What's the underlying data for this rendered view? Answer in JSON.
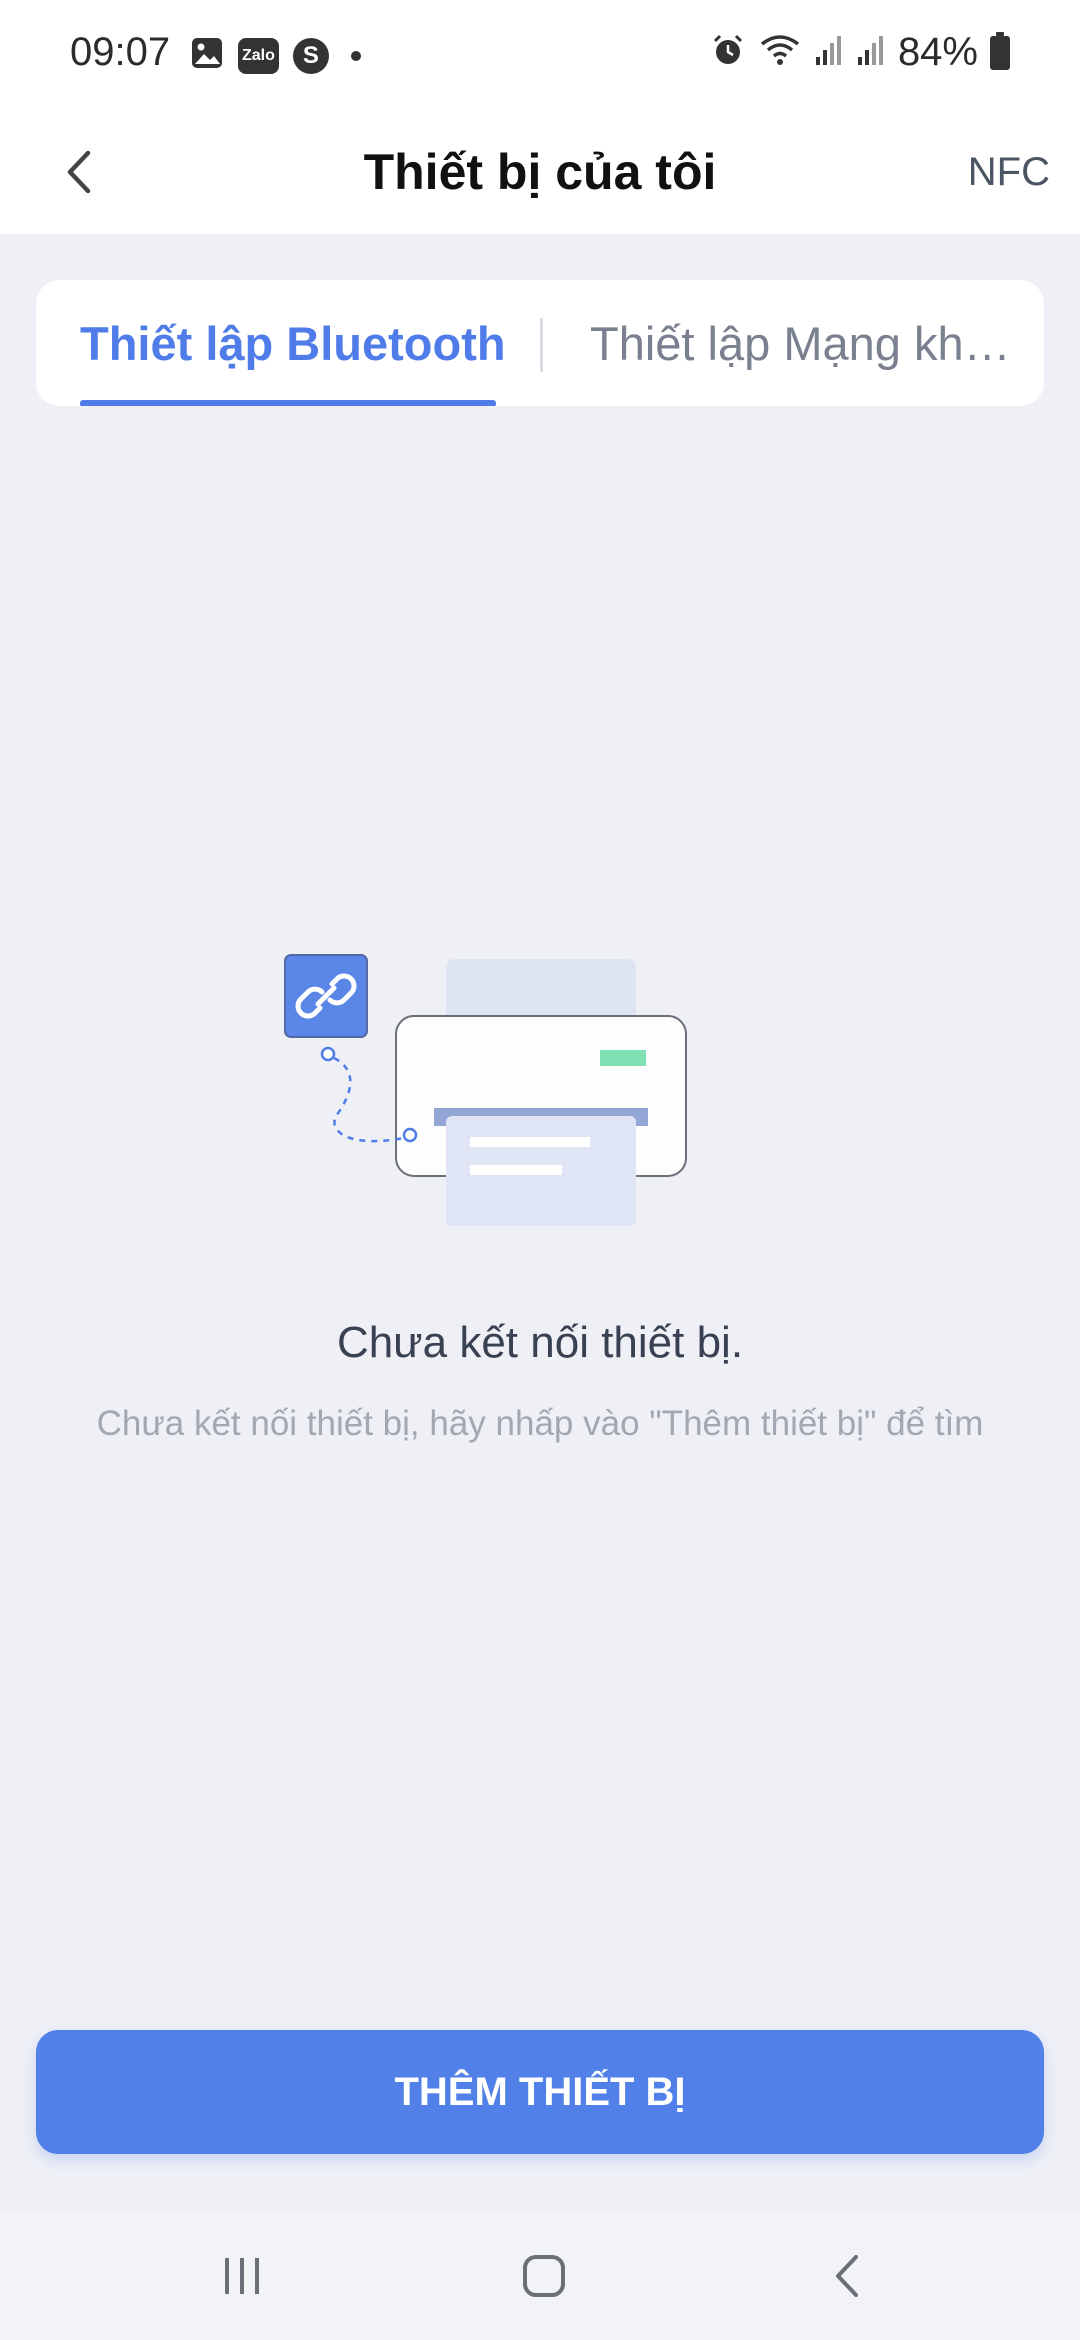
{
  "status_bar": {
    "time": "09:07",
    "notifications": [
      {
        "icon": "gallery-icon"
      },
      {
        "icon": "zalo-icon",
        "label": "Zalo"
      },
      {
        "icon": "skype-icon",
        "label": "S"
      }
    ],
    "system_icons": [
      "alarm-icon",
      "wifi-icon",
      "signal-icon",
      "signal-icon"
    ],
    "battery": "84%"
  },
  "header": {
    "back_icon": "chevron-left-icon",
    "title": "Thiết bị của tôi",
    "nfc_label": "NFC"
  },
  "tabs": [
    {
      "label": "Thiết lập Bluetooth",
      "active": true
    },
    {
      "label": "Thiết lập Mạng không dây",
      "active": false
    }
  ],
  "empty_state": {
    "illustration": "printer-link-icon",
    "title": "Chưa kết nối thiết bị.",
    "subtitle": "Chưa kết nối thiết bị, hãy nhấp vào \"Thêm thiết bị\" để tìm"
  },
  "primary_action": {
    "label": "THÊM THIẾT BỊ"
  },
  "colors": {
    "accent": "#4f7ce8",
    "button": "#5080e8",
    "background": "#eff0f6",
    "illustration_green": "#7fe0b3",
    "illustration_light_blue": "#dfe5f5"
  },
  "nav_bar": {
    "items": [
      "recents-icon",
      "home-icon",
      "back-icon"
    ]
  }
}
